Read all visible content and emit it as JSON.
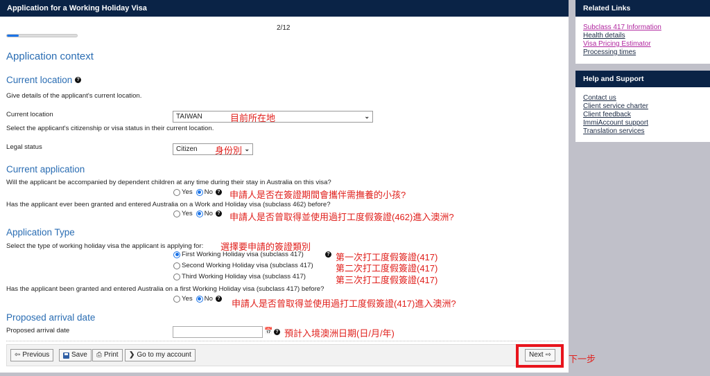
{
  "header": {
    "title": "Application for a Working Holiday Visa"
  },
  "progress": {
    "step_label": "2/12",
    "fraction": 0.1667
  },
  "page_title": "Application context",
  "sections": {
    "current_location": {
      "title": "Current location",
      "intro": "Give details of the applicant's current location.",
      "location_label": "Current location",
      "location_value": "TAIWAN",
      "location_annotation": "目前所在地",
      "status_hint": "Select the applicant's citizenship or visa status in their current location.",
      "legal_status_label": "Legal status",
      "legal_status_value": "Citizen",
      "legal_status_annotation": "身份別"
    },
    "current_application": {
      "title": "Current application",
      "questions": [
        {
          "text": "Will the applicant be accompanied by dependent children at any time during their stay in Australia on this visa?",
          "options": [
            "Yes",
            "No"
          ],
          "selected": "No",
          "annotation": "申請人是否在簽證期間會攜伴需撫養的小孩?"
        },
        {
          "text": "Has the applicant ever been granted and entered Australia on a Work and Holiday visa (subclass 462) before?",
          "options": [
            "Yes",
            "No"
          ],
          "selected": "No",
          "annotation": "申請人是否曾取得並使用過打工度假簽證(462)進入澳洲?"
        }
      ]
    },
    "application_type": {
      "title": "Application Type",
      "prompt": "Select the type of working holiday visa the applicant is applying for:",
      "prompt_annotation": "選擇要申請的簽證類別",
      "visa_options": [
        {
          "label": "First Working Holiday visa (subclass 417)",
          "selected": true,
          "annotation": "第一次打工度假簽證(417)"
        },
        {
          "label": "Second Working Holiday visa (subclass 417)",
          "selected": false,
          "annotation": "第二次打工度假簽證(417)"
        },
        {
          "label": "Third Working Holiday visa (subclass 417)",
          "selected": false,
          "annotation": "第三次打工度假簽證(417)"
        }
      ],
      "prior_question": {
        "text": "Has the applicant been granted and entered Australia on a first Working Holiday visa (subclass 417) before?",
        "options": [
          "Yes",
          "No"
        ],
        "selected": "No",
        "annotation": "申請人是否曾取得並使用過打工度假簽證(417)進入澳洲?"
      }
    },
    "arrival": {
      "title": "Proposed arrival date",
      "label": "Proposed arrival date",
      "value": "",
      "annotation": "預計入境澳洲日期(日/月/年)"
    }
  },
  "footer": {
    "previous": "Previous",
    "save": "Save",
    "print": "Print",
    "account": "Go to my account",
    "next": "Next",
    "next_annotation": "下一步"
  },
  "sidebar": {
    "related": {
      "title": "Related Links",
      "links": [
        "Subclass 417 Information",
        "Health details",
        "Visa Pricing Estimator",
        "Processing times"
      ]
    },
    "help": {
      "title": "Help and Support",
      "links": [
        "Contact us",
        "Client service charter",
        "Client feedback",
        "ImmiAccount support",
        "Translation services"
      ]
    }
  },
  "colors": {
    "header_bg": "#0a2346",
    "accent": "#2a6db3",
    "annotation": "#e0201c",
    "visited_link": "#b0249e"
  }
}
